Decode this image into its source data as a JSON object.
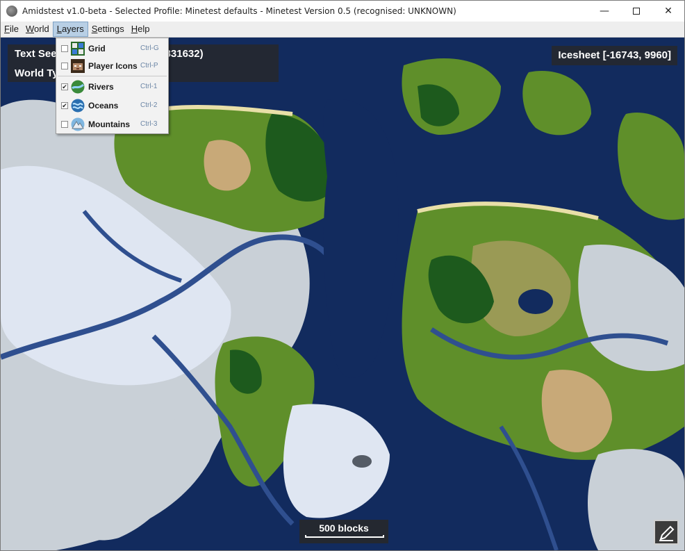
{
  "window": {
    "title": "Amidstest v1.0-beta - Selected Profile: Minetest defaults - Minetest Version 0.5 (recognised: UNKNOWN)",
    "minimize_glyph": "—",
    "close_glyph": "✕"
  },
  "menubar": {
    "items": [
      {
        "mnemonic": "F",
        "rest": "ile"
      },
      {
        "mnemonic": "W",
        "rest": "orld"
      },
      {
        "mnemonic": "L",
        "rest": "ayers"
      },
      {
        "mnemonic": "S",
        "rest": "ettings"
      },
      {
        "mnemonic": "H",
        "rest": "elp"
      }
    ]
  },
  "layers_menu": {
    "items": [
      {
        "label": "Grid",
        "shortcut": "Ctrl-G",
        "checked": false,
        "icon": "grid-icon"
      },
      {
        "label": "Player Icons",
        "shortcut": "Ctrl-P",
        "checked": false,
        "icon": "player-icon"
      },
      {
        "label": "Rivers",
        "shortcut": "Ctrl-1",
        "checked": true,
        "icon": "rivers-icon"
      },
      {
        "label": "Oceans",
        "shortcut": "Ctrl-2",
        "checked": true,
        "icon": "oceans-icon"
      },
      {
        "label": "Mountains",
        "shortcut": "Ctrl-3",
        "checked": false,
        "icon": "mountains-icon"
      }
    ],
    "check_glyph": "✔"
  },
  "map": {
    "seed_line": "Text Seed: (5079702311861944831632)",
    "world_type_line": "World Type: ...",
    "biome_readout": "Icesheet [-16743, 9960]",
    "scale_label": "500 blocks",
    "colors": {
      "ocean": "#122b5e",
      "river": "#2f4f8f",
      "icesheet": "#dfe6f2",
      "tundra": "#c9d0d7",
      "grassland": "#5f8f2a",
      "forest": "#1d5a1d",
      "savanna": "#9a9a55",
      "desert": "#c8a978",
      "beach": "#e8dfa8"
    }
  }
}
